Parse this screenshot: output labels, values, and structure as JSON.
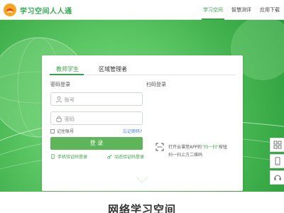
{
  "header": {
    "brand": "学习空间人人通",
    "nav": [
      {
        "label": "学习空间",
        "active": true
      },
      {
        "label": "智慧测评",
        "active": false
      },
      {
        "label": "应用下载",
        "active": false
      }
    ]
  },
  "login": {
    "tabs": [
      {
        "label": "教师学生",
        "active": true
      },
      {
        "label": "区域管理者",
        "active": false
      }
    ],
    "password_section_title": "密码登录",
    "scan_section_title": "扫码登录",
    "account_placeholder": "账号",
    "password_placeholder": "密码",
    "remember_label": "记住账号",
    "forgot_label": "忘记密码?",
    "login_button": "登 录",
    "sms_login": "手机验证码登录",
    "dynamic_login": "动态验证码登录",
    "qr_line1_prefix": "打开云课堂APP的",
    "qr_line1_highlight": "\"扫一扫\"",
    "qr_line1_suffix": "按钮",
    "qr_line2": "扫一扫上方二维码"
  },
  "section_title": "网络学习空间",
  "colors": {
    "accent": "#3aa14a",
    "button": "#5fb65a",
    "link": "#3b7dd8"
  },
  "icons": {
    "side_buttons": [
      "grid-icon",
      "phone-icon",
      "headset-icon"
    ]
  }
}
